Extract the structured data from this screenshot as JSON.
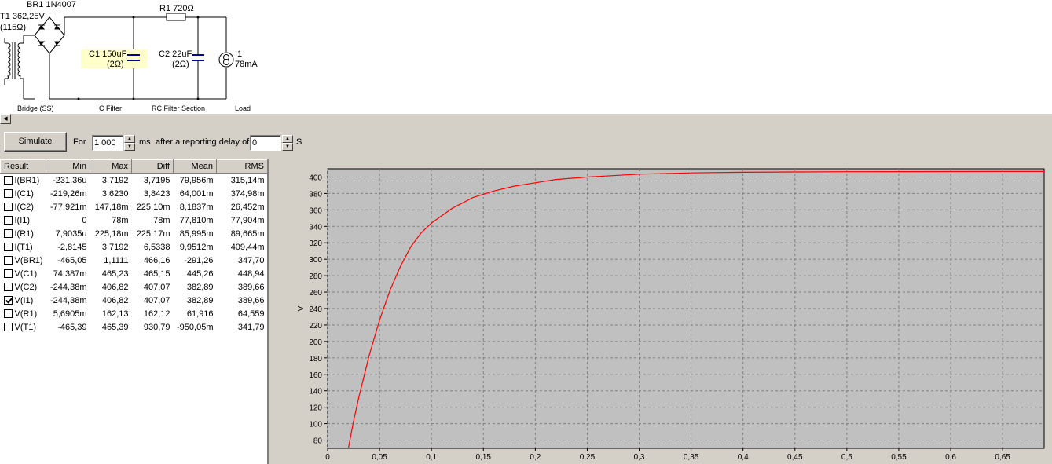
{
  "schematic": {
    "components": [
      {
        "name": "BR1",
        "value": "1N4007",
        "label": "BR1 1N4007"
      },
      {
        "name": "T1",
        "label_line1": "T1 362,25V",
        "label_line2": "(115Ω)"
      },
      {
        "name": "R1",
        "label": "R1 720Ω"
      },
      {
        "name": "C1",
        "label_line1": "C1 150uF",
        "label_line2": "(2Ω)"
      },
      {
        "name": "C2",
        "label_line1": "C2 22uF",
        "label_line2": "(2Ω)"
      },
      {
        "name": "I1",
        "label_line1": "I1",
        "label_line2": "78mA"
      }
    ],
    "captions": [
      "Bridge (SS)",
      "C Filter",
      "RC Filter Section",
      "Load"
    ]
  },
  "toolbar": {
    "simulate_label": "Simulate",
    "for_label": "For",
    "duration_value": "1 000",
    "duration_unit": "ms",
    "delay_label": "after a reporting delay of",
    "delay_value": "0",
    "delay_unit": "S"
  },
  "results": {
    "columns": [
      "Result",
      "Min",
      "Max",
      "Diff",
      "Mean",
      "RMS"
    ],
    "rows": [
      {
        "checked": false,
        "name": "I(BR1)",
        "min": "-231,36u",
        "max": "3,7192",
        "diff": "3,7195",
        "mean": "79,956m",
        "rms": "315,14m"
      },
      {
        "checked": false,
        "name": "I(C1)",
        "min": "-219,26m",
        "max": "3,6230",
        "diff": "3,8423",
        "mean": "64,001m",
        "rms": "374,98m"
      },
      {
        "checked": false,
        "name": "I(C2)",
        "min": "-77,921m",
        "max": "147,18m",
        "diff": "225,10m",
        "mean": "8,1837m",
        "rms": "26,452m"
      },
      {
        "checked": false,
        "name": "I(I1)",
        "min": "0",
        "max": "78m",
        "diff": "78m",
        "mean": "77,810m",
        "rms": "77,904m"
      },
      {
        "checked": false,
        "name": "I(R1)",
        "min": "7,9035u",
        "max": "225,18m",
        "diff": "225,17m",
        "mean": "85,995m",
        "rms": "89,665m"
      },
      {
        "checked": false,
        "name": "I(T1)",
        "min": "-2,8145",
        "max": "3,7192",
        "diff": "6,5338",
        "mean": "9,9512m",
        "rms": "409,44m"
      },
      {
        "checked": false,
        "name": "V(BR1)",
        "min": "-465,05",
        "max": "1,1111",
        "diff": "466,16",
        "mean": "-291,26",
        "rms": "347,70"
      },
      {
        "checked": false,
        "name": "V(C1)",
        "min": "74,387m",
        "max": "465,23",
        "diff": "465,15",
        "mean": "445,26",
        "rms": "448,94"
      },
      {
        "checked": false,
        "name": "V(C2)",
        "min": "-244,38m",
        "max": "406,82",
        "diff": "407,07",
        "mean": "382,89",
        "rms": "389,66"
      },
      {
        "checked": true,
        "name": "V(I1)",
        "min": "-244,38m",
        "max": "406,82",
        "diff": "407,07",
        "mean": "382,89",
        "rms": "389,66"
      },
      {
        "checked": false,
        "name": "V(R1)",
        "min": "5,6905m",
        "max": "162,13",
        "diff": "162,12",
        "mean": "61,916",
        "rms": "64,559"
      },
      {
        "checked": false,
        "name": "V(T1)",
        "min": "-465,39",
        "max": "465,39",
        "diff": "930,79",
        "mean": "-950,05m",
        "rms": "341,79"
      }
    ]
  },
  "chart_data": {
    "type": "line",
    "ylabel": "V",
    "xlim": [
      0,
      0.69
    ],
    "ylim": [
      70,
      410
    ],
    "yticks": [
      80,
      100,
      120,
      140,
      160,
      180,
      200,
      220,
      240,
      260,
      280,
      300,
      320,
      340,
      360,
      380,
      400
    ],
    "ytick_labels": [
      "80",
      "100",
      "120",
      "140",
      "160",
      "180",
      "200",
      "220",
      "240",
      "260",
      "280",
      "300",
      "320",
      "340",
      "360",
      "380",
      "400"
    ],
    "xticks": [
      0,
      0.05,
      0.1,
      0.15,
      0.2,
      0.25,
      0.3,
      0.35,
      0.4,
      0.45,
      0.5,
      0.55,
      0.6,
      0.65
    ],
    "xtick_labels": [
      "0",
      "0,05",
      "0,1",
      "0,15",
      "0,2",
      "0,25",
      "0,3",
      "0,35",
      "0,4",
      "0,45",
      "0,5",
      "0,55",
      "0,6",
      "0,65"
    ],
    "grid": true,
    "series": [
      {
        "color": "#ff0000",
        "x": [
          0.02,
          0.025,
          0.03,
          0.04,
          0.05,
          0.06,
          0.07,
          0.08,
          0.09,
          0.1,
          0.12,
          0.14,
          0.16,
          0.18,
          0.2,
          0.22,
          0.25,
          0.3,
          0.35,
          0.4,
          0.45,
          0.5,
          0.55,
          0.6,
          0.65,
          0.69
        ],
        "y": [
          70,
          103,
          132,
          183,
          226,
          262,
          291,
          315,
          332,
          344,
          362,
          375,
          383,
          389,
          393,
          397,
          400,
          403.5,
          405,
          405.8,
          406.2,
          406.5,
          406.6,
          406.7,
          406.8,
          406.8
        ]
      }
    ],
    "plot_bg": "#c0c0c0",
    "grid_color": "#808080"
  }
}
